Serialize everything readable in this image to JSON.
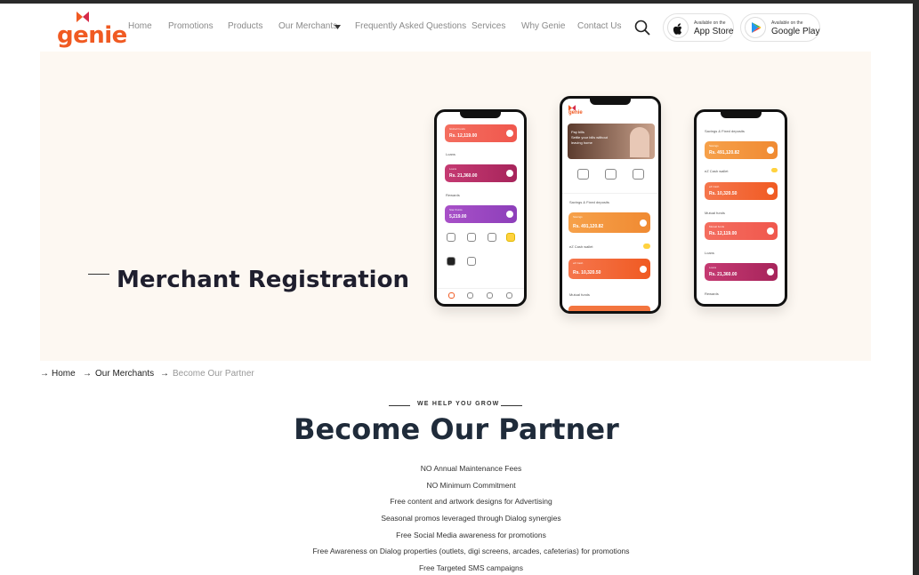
{
  "brand": {
    "name": "genie",
    "accent": "#f05a22"
  },
  "nav": {
    "items": [
      "Home",
      "Promotions",
      "Products",
      "Our Merchants",
      "Frequently Asked Questions",
      "Services",
      "Why Genie",
      "Contact Us"
    ],
    "search_icon": "search-icon",
    "app_store": {
      "small": "Available on the",
      "big": "App Store"
    },
    "google_play": {
      "small": "Available on the",
      "big": "Google Play"
    }
  },
  "hero": {
    "title": "Merchant Registration",
    "phone_left": {
      "cards": [
        {
          "label": "Global Funds",
          "amount": "Rs. 12,119.00"
        },
        {
          "label": "Loans",
          "amount": "Rs. 21,360.00"
        },
        {
          "label": "Star Points",
          "amount": "5,219.00"
        }
      ],
      "sections": [
        "Loans",
        "Rewards"
      ]
    },
    "phone_center": {
      "banner": "Pay bills\nSettle your bills without leaving home",
      "section1": "Savings & Fixed deposits",
      "cards": [
        {
          "label": "Savings",
          "amount": "Rs. 491,120.82"
        },
        {
          "label": "eZ Cash",
          "amount": "Rs. 10,320.50"
        }
      ],
      "section2": "eZ Cash wallet",
      "section3": "Mutual funds"
    },
    "phone_right": {
      "section1": "Savings & Fixed deposits",
      "cards": [
        {
          "label": "Savings",
          "amount": "Rs. 491,120.82"
        },
        {
          "label": "eZ Cash",
          "amount": "Rs. 10,320.50"
        },
        {
          "label": "Mutual funds",
          "amount": "Rs. 12,119.00"
        },
        {
          "label": "Loans",
          "amount": "Rs. 21,360.00"
        }
      ],
      "sections": [
        "eZ Cash wallet",
        "Mutual funds",
        "Loans",
        "Rewards"
      ]
    }
  },
  "breadcrumb": [
    "Home",
    "Our Merchants",
    "Become Our Partner"
  ],
  "partner": {
    "eyebrow": "WE HELP YOU GROW",
    "title": "Become Our Partner",
    "benefits": [
      "NO Annual Maintenance Fees",
      "NO Minimum Commitment",
      "Free content and artwork designs for Advertising",
      "Seasonal promos leveraged through Dialog synergies",
      "Free Social Media awareness for promotions",
      "Free Awareness on Dialog properties (outlets, digi screens, arcades, cafeterias) for promotions",
      "Free Targeted SMS campaigns"
    ]
  }
}
